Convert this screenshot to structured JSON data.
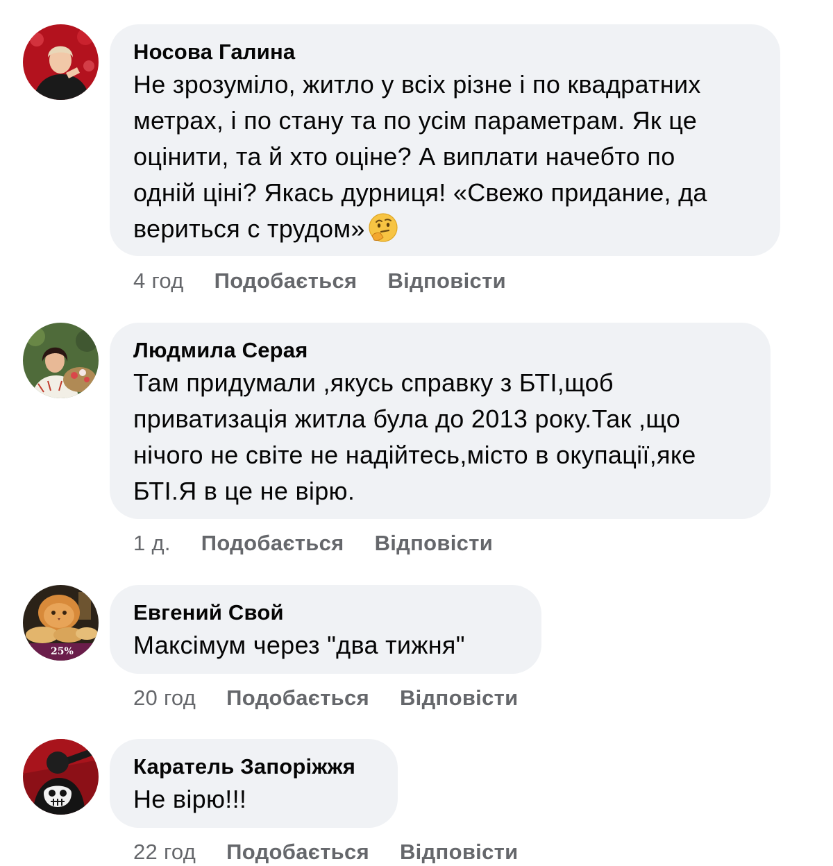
{
  "comments": [
    {
      "author": "Носова Галина",
      "lines": [
        "Не зрозуміло, житло у всіх різне і по квадратних",
        "метрах, і по стану та по усім параметрам. Як це",
        "оцінити, та й хто оціне? А виплати начебто по",
        "одній ціні? Якась дурниця! «Свежо придание, да",
        "вериться с трудом»"
      ],
      "emoji": "thinking-face",
      "time": "4 год",
      "like_label": "Подобається",
      "reply_label": "Відповісти"
    },
    {
      "author": "Людмила Серая",
      "lines": [
        "Там придумали ,якусь справку з БТІ,щоб",
        "приватизація житла була до 2013 року.Так ,що",
        "нічого не світе не надійтесь,місто в окупації,яке",
        "БТІ.Я в це не вірю."
      ],
      "time": "1 д.",
      "like_label": "Подобається",
      "reply_label": "Відповісти"
    },
    {
      "author": "Евгений Свой",
      "lines": [
        "Максімум через \"два тижня\""
      ],
      "avatar_badge": "25%",
      "time": "20 год",
      "like_label": "Подобається",
      "reply_label": "Відповісти"
    },
    {
      "author": "Каратель Запоріжжя",
      "lines": [
        "Не вірю!!!"
      ],
      "time": "22 год",
      "like_label": "Подобається",
      "reply_label": "Відповісти"
    }
  ],
  "colors": {
    "bubble": "#f0f2f5",
    "text": "#050505",
    "meta": "#65676b"
  }
}
